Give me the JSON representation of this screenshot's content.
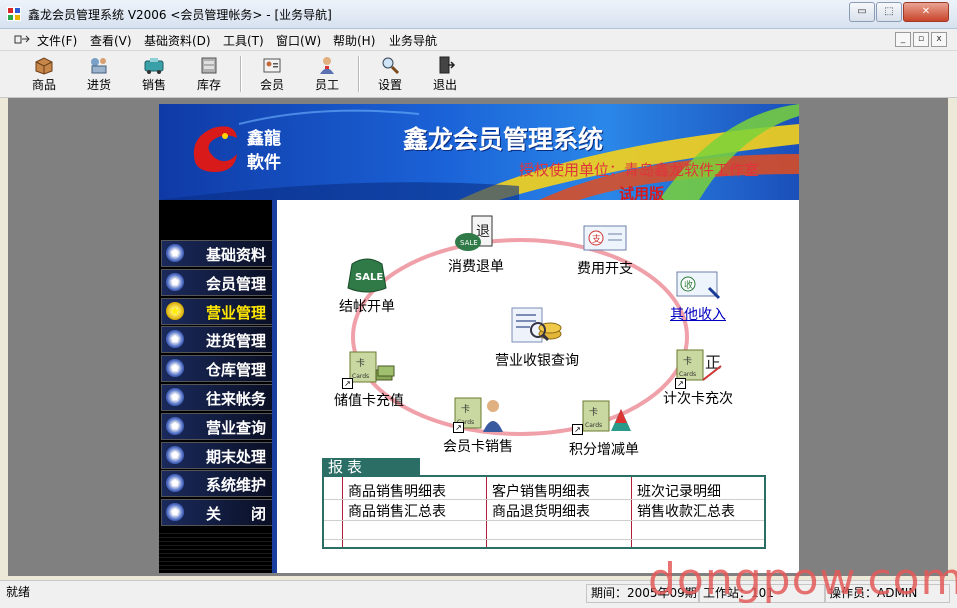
{
  "window": {
    "title": "鑫龙会员管理系统 V2006 <会员管理帐务> - [业务导航]",
    "minimize_glyph": "▭",
    "maximize_glyph": "⬚",
    "close_glyph": "✕"
  },
  "menu": {
    "items": [
      "文件(F)",
      "查看(V)",
      "基础资料(D)",
      "工具(T)",
      "窗口(W)",
      "帮助(H)",
      "业务导航"
    ]
  },
  "toolbar": {
    "items": [
      {
        "label": "商品",
        "icon": "goods-box-icon"
      },
      {
        "label": "进货",
        "icon": "purchase-icon"
      },
      {
        "label": "销售",
        "icon": "sales-icon"
      },
      {
        "label": "库存",
        "icon": "inventory-icon"
      },
      {
        "label": "会员",
        "icon": "member-icon"
      },
      {
        "label": "员工",
        "icon": "employee-icon"
      },
      {
        "label": "设置",
        "icon": "settings-magnifier-icon"
      },
      {
        "label": "退出",
        "icon": "exit-door-icon"
      }
    ]
  },
  "banner": {
    "logo_line1": "鑫龍",
    "logo_line2": "軟件",
    "title": "鑫龙会员管理系统",
    "subtitle": "授权使用单位：青岛鑫龙软件工作室",
    "trial": "试用版"
  },
  "sidebar": {
    "items": [
      {
        "label": "基础资料",
        "active": false
      },
      {
        "label": "会员管理",
        "active": false
      },
      {
        "label": "营业管理",
        "active": true
      },
      {
        "label": "进货管理",
        "active": false
      },
      {
        "label": "仓库管理",
        "active": false
      },
      {
        "label": "往来帐务",
        "active": false
      },
      {
        "label": "营业查询",
        "active": false
      },
      {
        "label": "期末处理",
        "active": false
      },
      {
        "label": "系统维护",
        "active": false
      },
      {
        "label": "关　　闭",
        "active": false
      }
    ]
  },
  "workflow": {
    "center": "营业收银查询",
    "nodes": {
      "checkout": "结帐开单",
      "refund": "消费退单",
      "expense": "费用开支",
      "other_income": "其他收入",
      "count_card": "计次卡充次",
      "points": "积分增减单",
      "member_card_sale": "会员卡销售",
      "stored_card": "储值卡充值"
    },
    "colors": {
      "ring": "#f0a0a8"
    }
  },
  "report": {
    "tab": "报表",
    "rows": [
      [
        "商品销售明细表",
        "客户销售明细表",
        "班次记录明细"
      ],
      [
        "商品销售汇总表",
        "商品退货明细表",
        "销售收款汇总表"
      ]
    ]
  },
  "status": {
    "ready": "就绪",
    "period": "期间：2005年09期",
    "workstation": "工作站：101",
    "operator": "操作员：ADMIN"
  },
  "watermark": "dongpow.com"
}
